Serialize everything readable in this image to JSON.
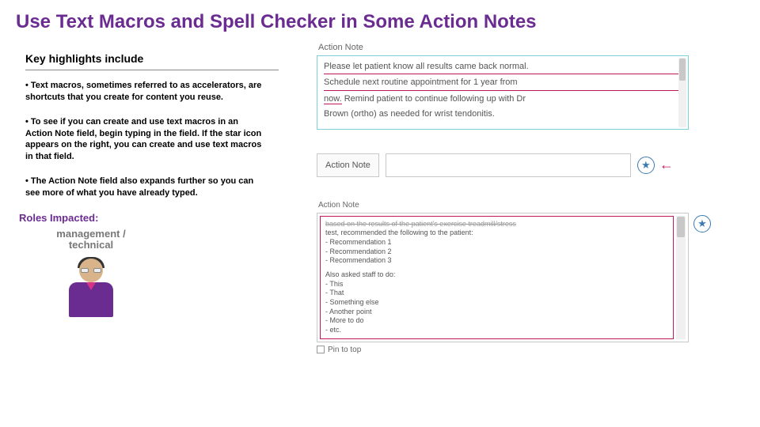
{
  "title": "Use Text Macros and Spell Checker in Some Action Notes",
  "subheading": "Key highlights include",
  "bullets": [
    "• Text macros, sometimes referred to as accelerators, are shortcuts that you create for content you reuse.",
    "• To see if you can create and use text macros in an Action Note field, begin typing in the field. If the star icon appears on the right, you can create and use text macros in that field.",
    "• The Action Note field also expands further so you can see more of what you have already typed."
  ],
  "roles_label": "Roles Impacted:",
  "role_name": "management / technical",
  "panel1": {
    "label": "Action Note",
    "line1": "Please let patient know all results came back normal.",
    "line2": "Schedule next routine appointment for 1 year from",
    "line3a": "now.",
    "line3b": " Remind patient to continue following up with Dr",
    "line4": "Brown (ortho) as needed for wrist tendonitis."
  },
  "panel2": {
    "label": "Action Note"
  },
  "panel3": {
    "label": "Action Note",
    "top_line": "based on the results of the patient's exercise treadmill/stress",
    "l1": "test, recommended the following to the patient:",
    "l2": "- Recommendation 1",
    "l3": "- Recommendation 2",
    "l4": "- Recommendation 3",
    "l5": "Also asked staff to do:",
    "l6": "- This",
    "l7": "- That",
    "l8": "- Something else",
    "l9": "- Another point",
    "l10": "- More to do",
    "l11": "- etc.",
    "pin": "Pin to top"
  }
}
